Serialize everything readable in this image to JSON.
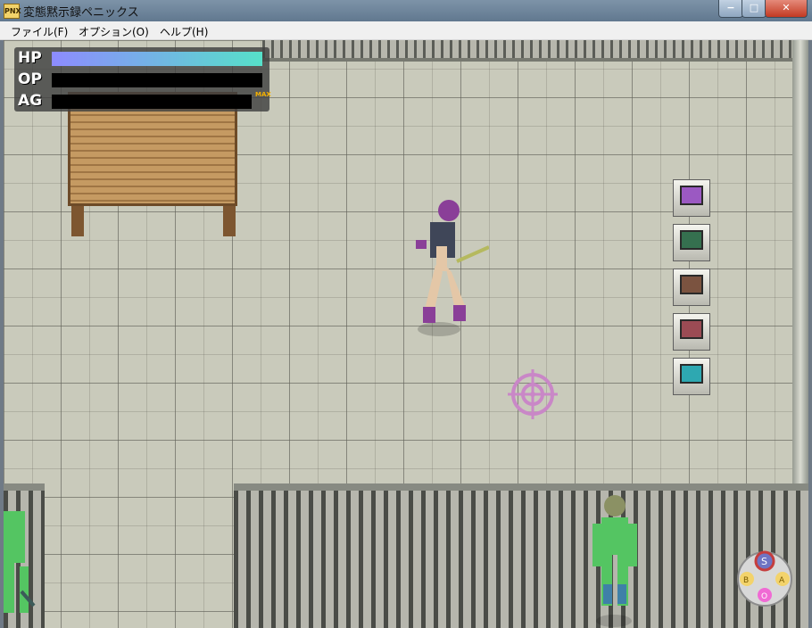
{
  "window": {
    "title": "変態黙示録ペニックス",
    "app_icon_label": "PNX",
    "controls": {
      "minimize": "−",
      "maximize": "□",
      "close": "✕"
    }
  },
  "menu": {
    "items": [
      "ファイル(F)",
      "オプション(O)",
      "ヘルプ(H)"
    ]
  },
  "hud": {
    "hp_label": "HP",
    "op_label": "OP",
    "ag_label": "AG",
    "hp_level": 1.0,
    "op_level": 0.0,
    "ag_level": 0.0,
    "max_label": "MAX"
  },
  "panel": {
    "keys": [
      {
        "name": "purple",
        "color": "#9b59c2"
      },
      {
        "name": "green",
        "color": "#35704f"
      },
      {
        "name": "brown",
        "color": "#7b5340"
      },
      {
        "name": "red",
        "color": "#9b4b54"
      },
      {
        "name": "teal",
        "color": "#2ea8b1"
      }
    ]
  },
  "controller": {
    "buttons": [
      "S",
      "B",
      "A",
      "O"
    ]
  },
  "colors": {
    "crosshair": "#c987c7",
    "player_suit": "#8a3f98",
    "enemy_suit": "#54c562"
  }
}
